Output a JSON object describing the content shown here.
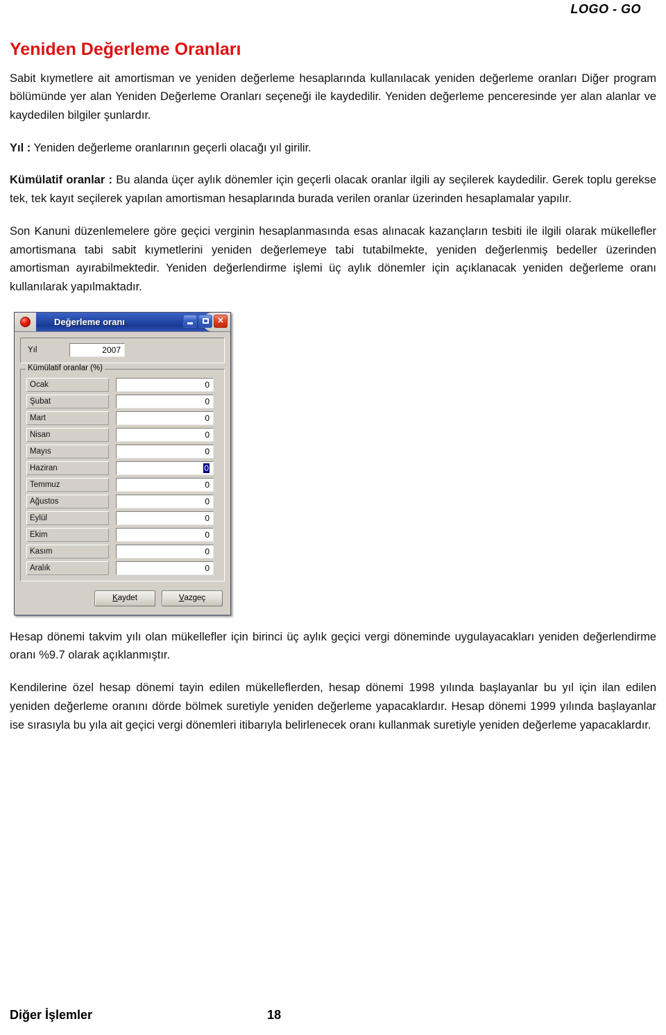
{
  "header": {
    "logo": "LOGO - GO"
  },
  "title": "Yeniden Değerleme Oranları",
  "paragraphs": {
    "intro": "Sabit kıymetlere ait amortisman ve yeniden değerleme hesaplarında kullanılacak yeniden değerleme oranları Diğer program bölümünde  yer alan Yeniden Değerleme Oranları seçeneği ile kaydedilir. Yeniden değerleme penceresinde yer alan alanlar ve kaydedilen bilgiler şunlardır.",
    "yil_label": "Yıl :",
    "yil_text": " Yeniden değerleme oranlarının geçerli olacağı yıl girilir.",
    "kumulatif_label": "Kümülatif oranlar :",
    "kumulatif_text": " Bu alanda üçer aylık dönemler için geçerli olacak oranlar ilgili ay seçilerek kaydedilir. Gerek toplu gerekse tek, tek kayıt seçilerek yapılan amortisman hesaplarında burada verilen oranlar üzerinden hesaplamalar yapılır.",
    "kanuni": "Son Kanuni düzenlemelere göre geçici verginin hesaplanmasında  esas alınacak kazançların tesbiti ile ilgili olarak mükellefler amortismana tabi sabit kıymetlerini yeniden değerlemeye tabi tutabilmekte, yeniden değerlenmiş bedeller üzerinden amortisman ayırabilmektedir. Yeniden değerlendirme işlemi üç aylık dönemler için açıklanacak yeniden değerleme oranı kullanılarak yapılmaktadır.",
    "hesap_donemi": "Hesap dönemi takvim yılı olan mükellefler için birinci üç aylık geçici vergi döneminde uygulayacakları yeniden değerlendirme oranı %9.7 olarak açıklanmıştır.",
    "ozel_hesap": "Kendilerine özel hesap dönemi tayin edilen mükelleflerden, hesap dönemi 1998 yılında başlayanlar bu yıl için ilan edilen yeniden değerleme oranını dörde bölmek suretiyle yeniden değerleme yapacaklardır.  Hesap dönemi 1999 yılında başlayanlar ise sırasıyla bu yıla ait geçici vergi dönemleri itibarıyla belirlenecek oranı kullanmak suretiyle yeniden değerleme yapacaklardır."
  },
  "dialog": {
    "title": "Değerleme oranı",
    "icon": "red-orb-icon",
    "window_buttons": {
      "minimize": "minimize-icon",
      "maximize": "maximize-icon",
      "close": "✕"
    },
    "year_label": "Yıl",
    "year_value": "2007",
    "group_legend": "Kümülatif oranlar (%)",
    "months": [
      {
        "name": "Ocak",
        "value": "0",
        "selected": false
      },
      {
        "name": "Şubat",
        "value": "0",
        "selected": false
      },
      {
        "name": "Mart",
        "value": "0",
        "selected": false
      },
      {
        "name": "Nisan",
        "value": "0",
        "selected": false
      },
      {
        "name": "Mayıs",
        "value": "0",
        "selected": false
      },
      {
        "name": "Haziran",
        "value": "0",
        "selected": true
      },
      {
        "name": "Temmuz",
        "value": "0",
        "selected": false
      },
      {
        "name": "Ağustos",
        "value": "0",
        "selected": false
      },
      {
        "name": "Eylül",
        "value": "0",
        "selected": false
      },
      {
        "name": "Ekim",
        "value": "0",
        "selected": false
      },
      {
        "name": "Kasım",
        "value": "0",
        "selected": false
      },
      {
        "name": "Aralık",
        "value": "0",
        "selected": false
      }
    ],
    "save_button": "Kaydet",
    "save_accel": "K",
    "cancel_button": "Vazgeç",
    "cancel_accel": "V"
  },
  "footer": {
    "section": "Diğer İşlemler",
    "page": "18"
  },
  "colors": {
    "title_red": "#DC1212",
    "titlebar_blue": "#2449A8",
    "selection_navy": "#000080",
    "dialog_face": "#D4D0C8"
  }
}
